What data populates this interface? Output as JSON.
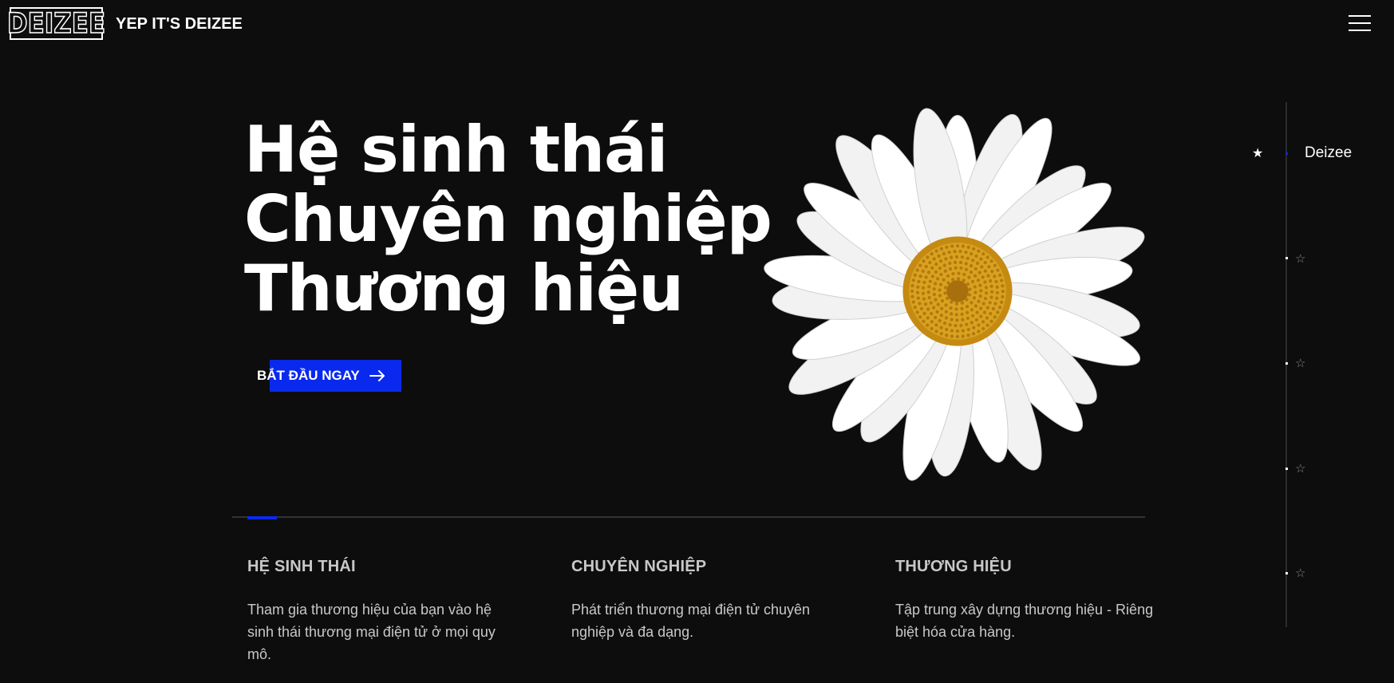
{
  "header": {
    "logo_text": "DEIZEE",
    "tagline": "YEP IT'S DEIZEE",
    "menu_icon": "hamburger-menu-icon"
  },
  "hero": {
    "title_lines": [
      "Hệ sinh thái",
      "Chuyên nghiệp",
      "Thương hiệu"
    ],
    "cta_label": "BẮT ĐẦU NGAY",
    "cta_icon": "arrow-right-icon",
    "image": "white-daisy-flower"
  },
  "features": [
    {
      "title": "HỆ SINH THÁI",
      "text": "Tham gia thương hiệu của bạn vào hệ sinh thái thương mại điện tử ở mọi quy mô."
    },
    {
      "title": "CHUYÊN NGHIỆP",
      "text": "Phát triển thương mại điện tử chuyên nghiệp và đa dạng."
    },
    {
      "title": "THƯƠNG HIỆU",
      "text": "Tập trung xây dựng thương hiệu - Riêng biệt hóa cửa hàng."
    }
  ],
  "slide_nav": {
    "active_label": "Deizee",
    "active_icon": "★",
    "inactive_icon": "☆"
  },
  "colors": {
    "background": "#0d0d0d",
    "accent": "#0a29ee",
    "text": "#ffffff",
    "muted_text": "#c8c8c8"
  }
}
